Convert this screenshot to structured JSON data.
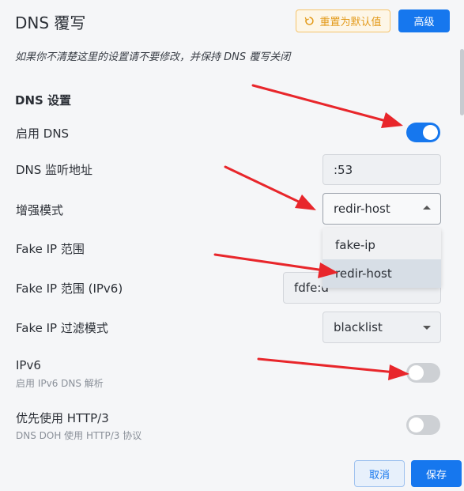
{
  "dialog": {
    "title": "DNS 覆写",
    "reset_label": "重置为默认值",
    "advanced_label": "高级",
    "hint": "如果你不清楚这里的设置请不要修改，并保持 DNS 覆写关闭"
  },
  "section": {
    "title": "DNS 设置"
  },
  "settings": {
    "enable_dns": {
      "label": "启用 DNS",
      "state": "on"
    },
    "listen": {
      "label": "DNS 监听地址",
      "value": ":53"
    },
    "enhanced_mode": {
      "label": "增强模式",
      "value": "redir-host",
      "options": [
        "fake-ip",
        "redir-host"
      ]
    },
    "fake_ip_range": {
      "label": "Fake IP 范围"
    },
    "fake_ip_range_v6": {
      "label": "Fake IP 范围 (IPv6)",
      "value": "fdfe:d"
    },
    "fake_ip_filter": {
      "label": "Fake IP 过滤模式",
      "value": "blacklist"
    },
    "ipv6": {
      "label": "IPv6",
      "sublabel": "启用 IPv6 DNS 解析",
      "state": "off"
    },
    "http3": {
      "label": "优先使用 HTTP/3",
      "sublabel": "DNS DOH 使用 HTTP/3 协议",
      "state": "off"
    }
  },
  "footer": {
    "cancel_label": "取消",
    "save_label": "保存"
  },
  "colors": {
    "accent": "#1677ee",
    "annotation_arrow": "#e8262b",
    "reset_text": "#e39a1a"
  }
}
